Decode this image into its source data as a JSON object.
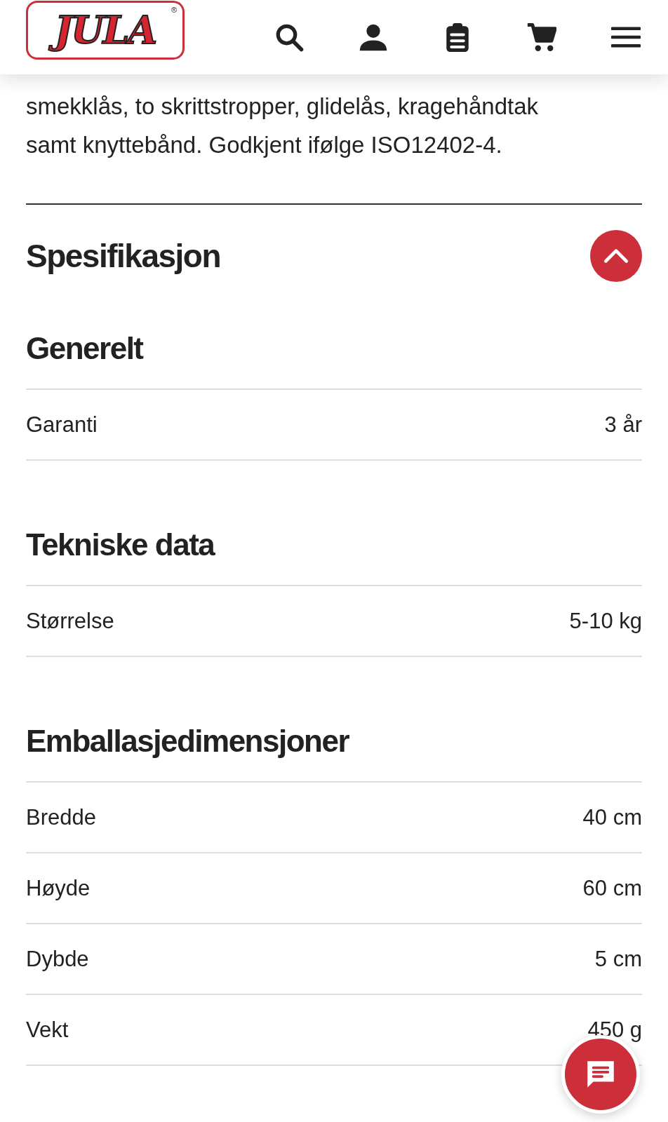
{
  "header": {
    "logo": {
      "text": "JULA",
      "mark": "®"
    },
    "icons": [
      {
        "kind": "search"
      },
      {
        "kind": "account"
      },
      {
        "kind": "list"
      },
      {
        "kind": "cart"
      },
      {
        "kind": "menu"
      }
    ]
  },
  "description": [
    "smekklås, to skrittstropper, glidelås, kragehåndtak",
    "samt knyttebånd. Godkjent ifølge ISO12402-4."
  ],
  "specification": {
    "title": "Spesifikasjon",
    "expanded": true,
    "groups": [
      {
        "title": "Generelt",
        "rows": [
          {
            "label": "Garanti",
            "value": "3 år"
          }
        ]
      },
      {
        "title": "Tekniske data",
        "rows": [
          {
            "label": "Størrelse",
            "value": "5-10 kg"
          }
        ]
      },
      {
        "title": "Emballasjedimensjoner",
        "rows": [
          {
            "label": "Bredde",
            "value": "40 cm"
          },
          {
            "label": "Høyde",
            "value": "60 cm"
          },
          {
            "label": "Dybde",
            "value": "5 cm"
          },
          {
            "label": "Vekt",
            "value": "450 g"
          }
        ]
      }
    ]
  },
  "chat_button": {
    "kind": "chat"
  }
}
